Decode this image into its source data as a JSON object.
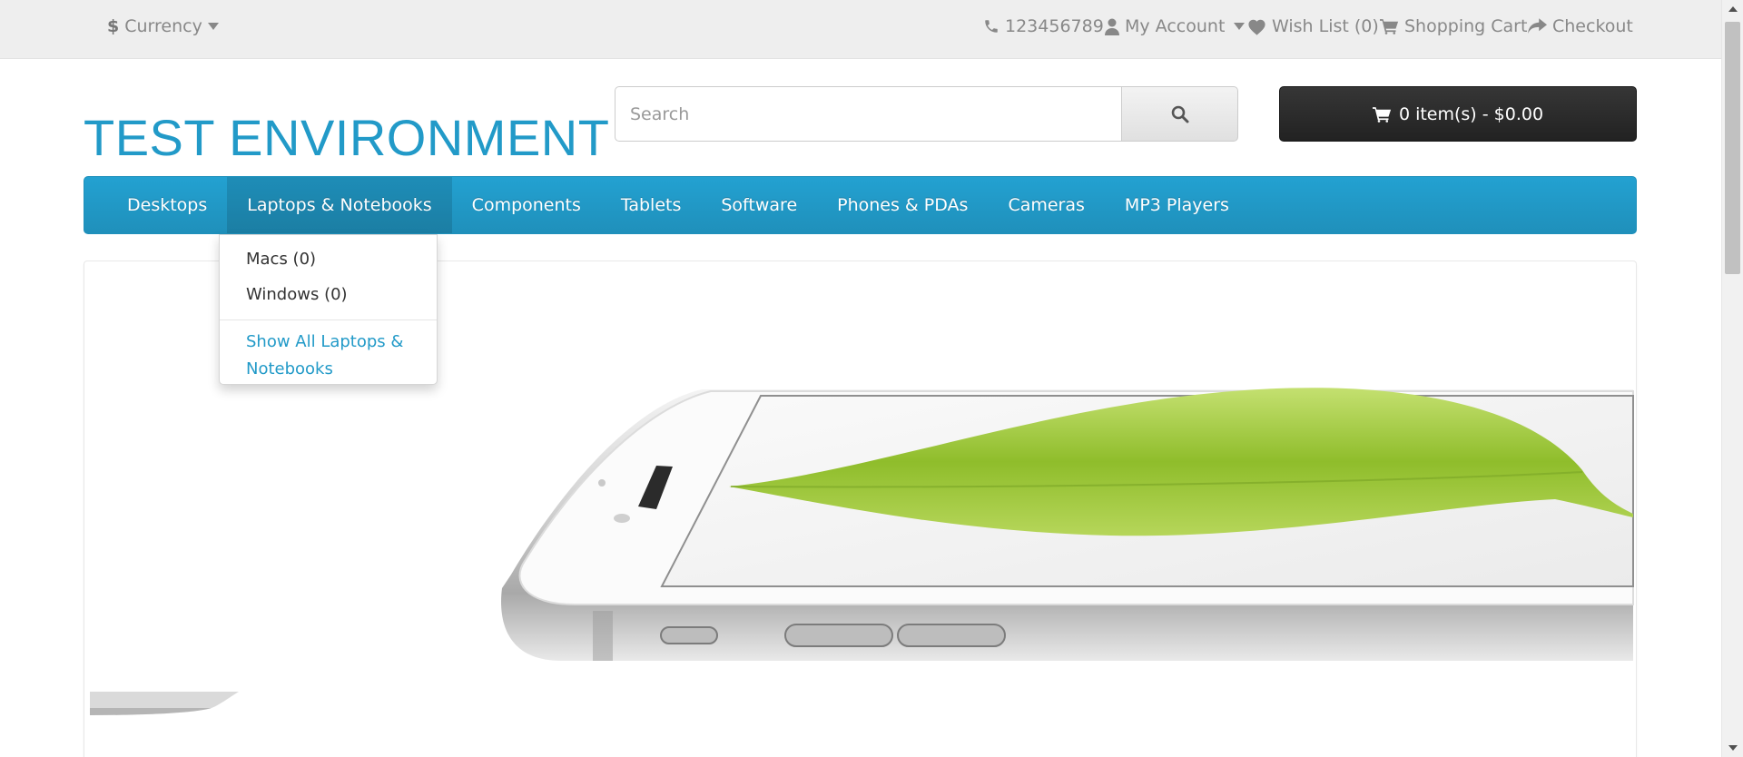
{
  "top_bar": {
    "currency_symbol": "$",
    "currency_label": "Currency",
    "phone": "123456789",
    "my_account": "My Account",
    "wish_list": "Wish List (0)",
    "shopping_cart": "Shopping Cart",
    "checkout": "Checkout"
  },
  "header": {
    "logo_text": "TEST ENVIRONMENT",
    "search_placeholder": "Search",
    "cart_summary": "0 item(s) - $0.00"
  },
  "menu": {
    "items": [
      {
        "label": "Desktops"
      },
      {
        "label": "Laptops & Notebooks",
        "active": true
      },
      {
        "label": "Components"
      },
      {
        "label": "Tablets"
      },
      {
        "label": "Software"
      },
      {
        "label": "Phones & PDAs"
      },
      {
        "label": "Cameras"
      },
      {
        "label": "MP3 Players"
      }
    ],
    "dropdown": {
      "items": [
        "Macs (0)",
        "Windows (0)"
      ],
      "show_all": "Show All Laptops & Notebooks"
    }
  },
  "colors": {
    "brand_blue": "#229ac8",
    "top_bar_bg": "#eeeeee",
    "cart_button_bg": "#2a2a2a"
  },
  "icons": {
    "phone": "phone-icon",
    "account": "user-icon",
    "wishlist": "heart-icon",
    "cart": "cart-icon",
    "checkout": "share-arrow-icon",
    "search": "search-icon"
  }
}
